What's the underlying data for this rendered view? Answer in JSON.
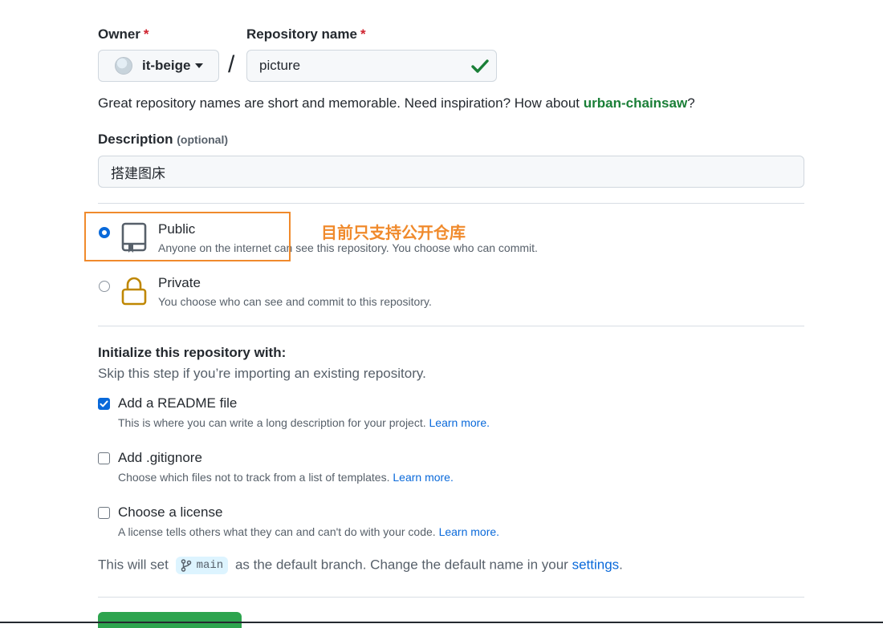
{
  "owner": {
    "label": "Owner",
    "required_mark": "*",
    "name": "it-beige"
  },
  "repo": {
    "label": "Repository name",
    "required_mark": "*",
    "value": "picture",
    "slash": "/"
  },
  "name_hint": {
    "prefix": "Great repository names are short and memorable. Need inspiration? How about ",
    "suggestion": "urban-chainsaw",
    "suffix": "?"
  },
  "description": {
    "label": "Description",
    "optional": "(optional)",
    "value": "搭建图床"
  },
  "visibility": {
    "public": {
      "title": "Public",
      "desc": "Anyone on the internet can see this repository. You choose who can commit.",
      "selected": true
    },
    "private": {
      "title": "Private",
      "desc": "You choose who can see and commit to this repository.",
      "selected": false
    }
  },
  "annotation": {
    "text": "目前只支持公开仓库",
    "color": "#f08a2c"
  },
  "init": {
    "heading": "Initialize this repository with:",
    "subheading": "Skip this step if you’re importing an existing repository.",
    "readme": {
      "title": "Add a README file",
      "desc": "This is where you can write a long description for your project.",
      "link": "Learn more.",
      "checked": true
    },
    "gitignore": {
      "title": "Add .gitignore",
      "desc": "Choose which files not to track from a list of templates.",
      "link": "Learn more.",
      "checked": false
    },
    "license": {
      "title": "Choose a license",
      "desc": "A license tells others what they can and can't do with your code.",
      "link": "Learn more.",
      "checked": false
    }
  },
  "branch_note": {
    "prefix": "This will set",
    "branch": "main",
    "middle": "as the default branch. Change the default name in your",
    "link": "settings",
    "suffix": "."
  },
  "colors": {
    "accent": "#0969da",
    "success": "#1a7f37",
    "create_button": "#2da44e",
    "annotation": "#f08a2c"
  }
}
